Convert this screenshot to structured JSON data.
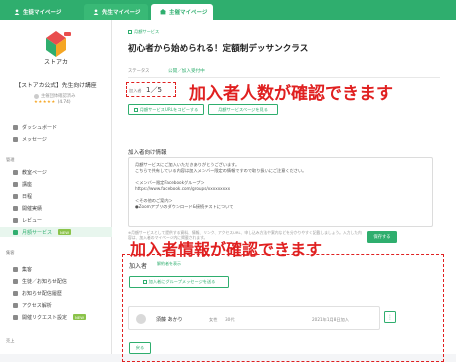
{
  "top_tabs": [
    {
      "label": "生徒マイページ"
    },
    {
      "label": "先生マイページ"
    },
    {
      "label": "主催マイページ"
    }
  ],
  "sidebar": {
    "shop_name": "【ストアカ公式】先生向け講座",
    "owner": "主催団体確認済み",
    "rating_stars": "★★★★★",
    "rating_value": "(4.74)",
    "top_items": [
      {
        "label": "ダッシュボード"
      },
      {
        "label": "メッセージ"
      }
    ],
    "section_manage": "管理",
    "manage_items": [
      {
        "label": "教室ページ"
      },
      {
        "label": "講座"
      },
      {
        "label": "日程"
      },
      {
        "label": "開催実績"
      },
      {
        "label": "レビュー"
      },
      {
        "label": "月額サービス",
        "badge": "NEW",
        "active": true
      }
    ],
    "section_gather": "集客",
    "gather_items": [
      {
        "label": "集客"
      },
      {
        "label": "生徒／お知らせ配信"
      },
      {
        "label": "お知らせ配信履歴"
      },
      {
        "label": "アクセス解析"
      },
      {
        "label": "開催リクエスト設定",
        "badge": "NEW"
      }
    ],
    "section_bottom": "売上"
  },
  "main": {
    "breadcrumb": "月額サービス",
    "title": "初心者から始められる！定額制デッサンクラス",
    "status_label": "ステータス",
    "status_value": "公開／加入受付中",
    "count_label": "加入者",
    "count_value": "1／5",
    "copy_url_button": "月額サービスURLをコピーする",
    "view_service_button": "月額サービスページを見る",
    "info_heading": "加入者向け情報",
    "info_lines": [
      "月額サービスにご加入いただきありがとうございます。",
      "こちらで共有している内容は加入メンバー限定の情報ですので取り扱いにご注意ください。",
      "",
      "＜メンバー限定Facebookグループ＞",
      "https://www.facebook.com/groups/xxxxxxxxx",
      "",
      "＜その他のご案内＞",
      "●Zoomアプリのダウンロード&接続テストについて"
    ],
    "info_note": "※月額サービスとして提供する資料、情報、リンク、アクセスURL、申し込み方法や案内などを分かりやすく記載しましょう。入力した内容は、加入者のマイページ内に掲載されます。",
    "save_button": "保存する",
    "participants_heading": "加入者",
    "participants_explain": "解約者を表示",
    "group_message_button": "加入者にグループメッセージを送る",
    "participant": {
      "name": "須藤 あかり",
      "gender": "女性",
      "age": "30代",
      "date": "2021年1月8日加入",
      "menu_icon": "⋮"
    },
    "back_button": "戻る"
  },
  "annotations": {
    "count_callout": "加入者人数が確認できます",
    "info_callout": "加入者情報が確認できます"
  }
}
